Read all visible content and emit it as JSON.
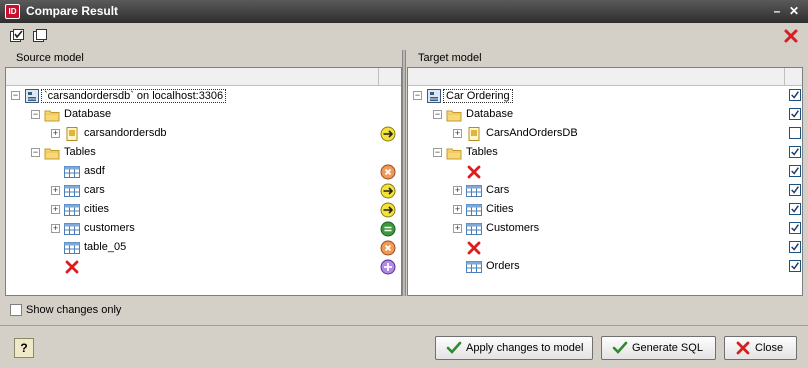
{
  "window": {
    "title": "Compare Result"
  },
  "source": {
    "label": "Source model",
    "rows": [
      {
        "text": "`carsandordersdb` on localhost:3306",
        "exp": "−",
        "icon": "model-icon",
        "state": ""
      },
      {
        "text": "Database",
        "exp": "−",
        "icon": "folder-icon",
        "state": ""
      },
      {
        "text": "carsandordersdb",
        "exp": "+",
        "icon": "database-icon",
        "state": "modified"
      },
      {
        "text": "Tables",
        "exp": "−",
        "icon": "folder-icon",
        "state": ""
      },
      {
        "text": "asdf",
        "exp": "",
        "icon": "table-icon",
        "state": "removed"
      },
      {
        "text": "cars",
        "exp": "+",
        "icon": "table-icon",
        "state": "modified"
      },
      {
        "text": "cities",
        "exp": "+",
        "icon": "table-icon",
        "state": "modified"
      },
      {
        "text": "customers",
        "exp": "+",
        "icon": "table-icon",
        "state": "equal"
      },
      {
        "text": "table_05",
        "exp": "",
        "icon": "table-icon",
        "state": "removed"
      },
      {
        "text": "",
        "exp": "",
        "icon": "missing-icon",
        "state": "added"
      }
    ]
  },
  "target": {
    "label": "Target model",
    "rows": [
      {
        "text": "Car Ordering",
        "exp": "−",
        "icon": "model-icon",
        "checked": true
      },
      {
        "text": "Database",
        "exp": "−",
        "icon": "folder-icon",
        "checked": true
      },
      {
        "text": "CarsAndOrdersDB",
        "exp": "+",
        "icon": "database-icon",
        "checked": false
      },
      {
        "text": "Tables",
        "exp": "−",
        "icon": "folder-icon",
        "checked": true
      },
      {
        "text": "",
        "exp": "",
        "icon": "missing-icon",
        "checked": true
      },
      {
        "text": "Cars",
        "exp": "+",
        "icon": "table-icon",
        "checked": true
      },
      {
        "text": "Cities",
        "exp": "+",
        "icon": "table-icon",
        "checked": true
      },
      {
        "text": "Customers",
        "exp": "+",
        "icon": "table-icon",
        "checked": true
      },
      {
        "text": "",
        "exp": "",
        "icon": "missing-icon",
        "checked": true
      },
      {
        "text": "Orders",
        "exp": "",
        "icon": "table-icon",
        "checked": true
      }
    ]
  },
  "show_changes_only": {
    "label": "Show changes only",
    "checked": false
  },
  "buttons": {
    "help": "?",
    "apply": "Apply changes to model",
    "generate": "Generate SQL",
    "close": "Close"
  }
}
